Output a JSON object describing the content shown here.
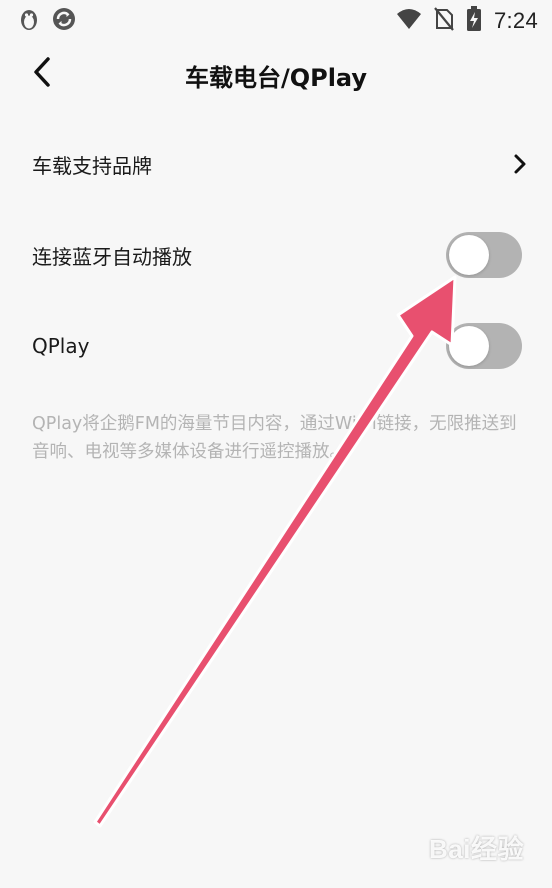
{
  "status_bar": {
    "time": "7:24",
    "left_icons": [
      "penguin-icon",
      "sync-icon"
    ],
    "right_icons": [
      "wifi-icon",
      "no-sim-icon",
      "battery-charging-icon"
    ]
  },
  "header": {
    "title": "车载电台/QPlay",
    "back_icon": "chevron-left-icon"
  },
  "settings": {
    "brands": {
      "label": "车载支持品牌",
      "icon": "chevron-right-icon"
    },
    "bluetooth_autoplay": {
      "label": "连接蓝牙自动播放",
      "enabled": false
    },
    "qplay": {
      "label": "QPlay",
      "enabled": false
    },
    "description": "QPlay将企鹅FM的海量节目内容，通过Wi-Fi链接，无限推送到音响、电视等多媒体设备进行遥控播放。"
  },
  "colors": {
    "background": "#f7f7f7",
    "toggle_off": "#b3b3b3",
    "description_text": "#b4b4b4",
    "annotation_arrow": "#e8506f"
  },
  "watermark": {
    "text": "Bai经验"
  }
}
